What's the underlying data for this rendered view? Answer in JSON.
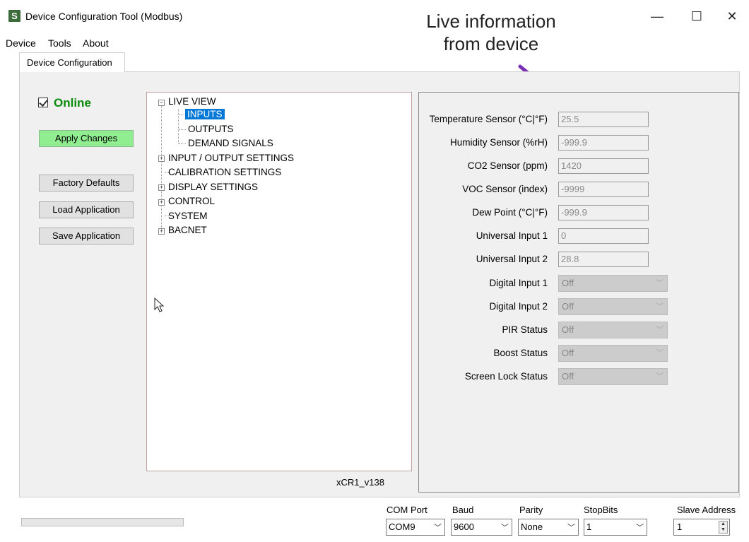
{
  "window": {
    "icon_letter": "S",
    "title": "Device Configuration Tool (Modbus)",
    "min_glyph": "—",
    "max_glyph": "☐",
    "close_glyph": "✕"
  },
  "annotation": {
    "line1": "Live information",
    "line2": "from device",
    "arrow_color": "#7b2fb5"
  },
  "menu": {
    "device": "Device",
    "tools": "Tools",
    "about": "About"
  },
  "tab": {
    "label": "Device Configuration"
  },
  "left": {
    "online_label": "Online",
    "online_checked": true,
    "apply_label": "Apply Changes",
    "factory_label": "Factory Defaults",
    "load_label": "Load Application",
    "save_label": "Save Application"
  },
  "tree": {
    "live_view": "LIVE VIEW",
    "inputs": "INPUTS",
    "outputs": "OUTPUTS",
    "demand": "DEMAND SIGNALS",
    "io_settings": "INPUT / OUTPUT SETTINGS",
    "calibration": "CALIBRATION SETTINGS",
    "display": "DISPLAY SETTINGS",
    "control": "CONTROL",
    "system": "SYSTEM",
    "bacnet": "BACNET",
    "expand_glyph": "+",
    "collapse_glyph": "−"
  },
  "version": "xCR1_v138",
  "live": {
    "text_fields": [
      {
        "label": "Temperature Sensor (°C|°F)",
        "value": "25.5"
      },
      {
        "label": "Humidity Sensor (%rH)",
        "value": "-999.9"
      },
      {
        "label": "CO2 Sensor (ppm)",
        "value": "1420"
      },
      {
        "label": "VOC Sensor (index)",
        "value": "-9999"
      },
      {
        "label": "Dew Point (°C|°F)",
        "value": "-999.9"
      },
      {
        "label": "Universal Input 1",
        "value": "0"
      },
      {
        "label": "Universal Input 2",
        "value": "28.8"
      }
    ],
    "select_fields": [
      {
        "label": "Digital Input 1",
        "value": "Off"
      },
      {
        "label": "Digital Input 2",
        "value": "Off"
      },
      {
        "label": "PIR Status",
        "value": "Off"
      },
      {
        "label": "Boost Status",
        "value": "Off"
      },
      {
        "label": "Screen Lock Status",
        "value": "Off"
      }
    ],
    "chevron": "﹀"
  },
  "bottom": {
    "com_label": "COM Port",
    "com_value": "COM9",
    "baud_label": "Baud",
    "baud_value": "9600",
    "parity_label": "Parity",
    "parity_value": "None",
    "stop_label": "StopBits",
    "stop_value": "1",
    "slave_label": "Slave Address",
    "slave_value": "1",
    "chevron": "﹀",
    "spin_up": "▲",
    "spin_down": "▼"
  }
}
